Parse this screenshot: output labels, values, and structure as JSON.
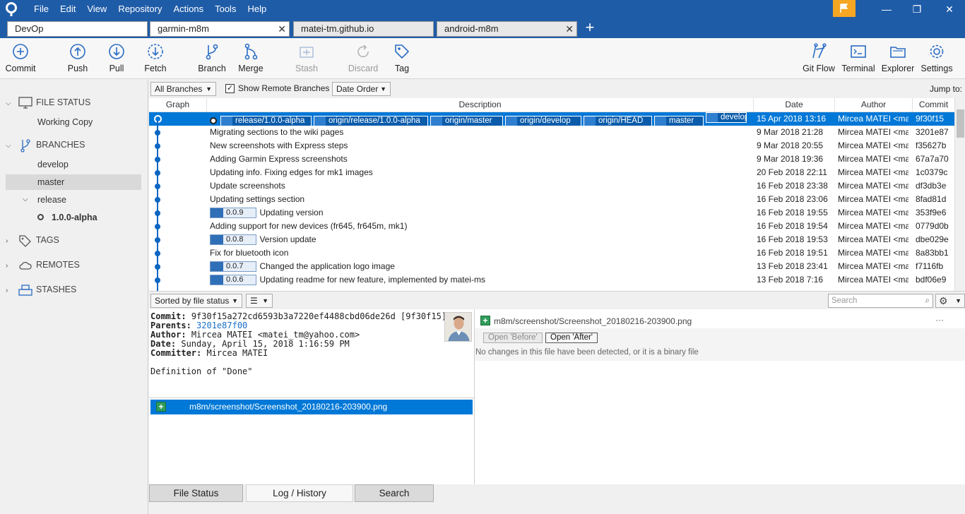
{
  "menu": [
    "File",
    "Edit",
    "View",
    "Repository",
    "Actions",
    "Tools",
    "Help"
  ],
  "window": {
    "minimize": "—",
    "maximize": "❐",
    "close": "✕"
  },
  "tabs": [
    {
      "label": "DevOp"
    },
    {
      "label": "garmin-m8m"
    },
    {
      "label": "matei-tm.github.io"
    },
    {
      "label": "android-m8m"
    }
  ],
  "tab_close": "✕",
  "tab_add": "+",
  "toolbar": {
    "commit": "Commit",
    "push": "Push",
    "pull": "Pull",
    "fetch": "Fetch",
    "branch": "Branch",
    "merge": "Merge",
    "stash": "Stash",
    "discard": "Discard",
    "tag": "Tag",
    "gitflow": "Git Flow",
    "terminal": "Terminal",
    "explorer": "Explorer",
    "settings": "Settings"
  },
  "sidebar": {
    "file_status": "FILE STATUS",
    "working_copy": "Working Copy",
    "branches": "BRANCHES",
    "develop": "develop",
    "master": "master",
    "release": "release",
    "release_child": "1.0.0-alpha",
    "tags": "TAGS",
    "remotes": "REMOTES",
    "stashes": "STASHES"
  },
  "filters": {
    "branches": "All Branches",
    "show_remote": "Show Remote Branches",
    "order": "Date Order",
    "jump_to": "Jump to:"
  },
  "columns": {
    "graph": "Graph",
    "description": "Description",
    "date": "Date",
    "author": "Author",
    "commit": "Commit"
  },
  "head_refs": [
    "release/1.0.0-alpha",
    "origin/release/1.0.0-alpha",
    "origin/master",
    "origin/develop",
    "origin/HEAD",
    "master",
    "develop"
  ],
  "commits": [
    {
      "tag": "",
      "desc": "",
      "date": "15 Apr 2018 13:16",
      "author": "Mircea MATEI <ma",
      "hash": "9f30f15"
    },
    {
      "tag": "",
      "desc": "Migrating sections to the wiki pages",
      "date": "9 Mar 2018 21:28",
      "author": "Mircea MATEI <ma",
      "hash": "3201e87"
    },
    {
      "tag": "",
      "desc": "New screenshots with Express steps",
      "date": "9 Mar 2018 20:55",
      "author": "Mircea MATEI <ma",
      "hash": "f35627b"
    },
    {
      "tag": "",
      "desc": "Adding Garmin Express screenshots",
      "date": "9 Mar 2018 19:36",
      "author": "Mircea MATEI <ma",
      "hash": "67a7a70"
    },
    {
      "tag": "",
      "desc": "Updating info. Fixing edges for mk1 images",
      "date": "20 Feb 2018 22:11",
      "author": "Mircea MATEI <ma",
      "hash": "1c0379c"
    },
    {
      "tag": "",
      "desc": "Update screenshots",
      "date": "16 Feb 2018 23:38",
      "author": "Mircea MATEI <ma",
      "hash": "df3db3e"
    },
    {
      "tag": "",
      "desc": "Updating settings section",
      "date": "16 Feb 2018 23:06",
      "author": "Mircea MATEI <ma",
      "hash": "8fad81d"
    },
    {
      "tag": "0.0.9",
      "desc": "Updating version",
      "date": "16 Feb 2018 19:55",
      "author": "Mircea MATEI <ma",
      "hash": "353f9e6"
    },
    {
      "tag": "",
      "desc": "Adding support for new devices (fr645, fr645m, mk1)",
      "date": "16 Feb 2018 19:54",
      "author": "Mircea MATEI <ma",
      "hash": "0779d0b"
    },
    {
      "tag": "0.0.8",
      "desc": "Version update",
      "date": "16 Feb 2018 19:53",
      "author": "Mircea MATEI <ma",
      "hash": "dbe029e"
    },
    {
      "tag": "",
      "desc": "Fix for bluetooth icon",
      "date": "16 Feb 2018 19:51",
      "author": "Mircea MATEI <ma",
      "hash": "8a83bb1"
    },
    {
      "tag": "0.0.7",
      "desc": "Changed the application logo image",
      "date": "13 Feb 2018 23:41",
      "author": "Mircea MATEI <ma",
      "hash": "f7116fb"
    },
    {
      "tag": "0.0.6",
      "desc": "Updating readme for new feature, implemented by matei-ms",
      "date": "13 Feb 2018 7:16",
      "author": "Mircea MATEI <ma",
      "hash": "bdf06e9"
    }
  ],
  "lower": {
    "sort": "Sorted by file status",
    "search_placeholder": "Search"
  },
  "details": {
    "commit_label": "Commit:",
    "commit_value": "9f30f15a272cd6593b3a7220ef4488cbd06de26d [9f30f15]",
    "parents_label": "Parents:",
    "parents_value": "3201e87f00",
    "author_label": "Author:",
    "author_value": "Mircea MATEI <matei_tm@yahoo.com>",
    "date_label": "Date:",
    "date_value": "Sunday, April 15, 2018 1:16:59 PM",
    "committer_label": "Committer:",
    "committer_value": "Mircea MATEI",
    "message": "Definition of \"Done\""
  },
  "files": {
    "path": "m8m/screenshot/Screenshot_20180216-203900.png"
  },
  "diff": {
    "path": "m8m/screenshot/Screenshot_20180216-203900.png",
    "open_before": "Open 'Before'",
    "open_after": "Open 'After'",
    "message": "No changes in this file have been detected, or it is a binary file",
    "more": "···"
  },
  "bottom_tabs": {
    "file_status": "File Status",
    "log": "Log / History",
    "search": "Search"
  },
  "colors": {
    "accent": "#1f5ca8",
    "selection": "#0078d7",
    "flag": "#f5a623"
  }
}
